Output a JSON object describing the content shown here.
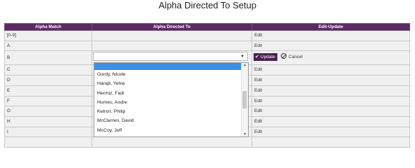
{
  "page": {
    "title": "Alpha Directed To Setup"
  },
  "table": {
    "headers": [
      "Alpha Match",
      "Alpha Directed To",
      "Edit-Update"
    ],
    "rows": [
      {
        "alpha": "[0-9]",
        "directed_to": "",
        "action": "Edit"
      },
      {
        "alpha": "A",
        "directed_to": "",
        "action": "Edit"
      },
      {
        "alpha": "B",
        "directed_to": "",
        "action": ""
      },
      {
        "alpha": "C",
        "directed_to": "",
        "action": "Edit"
      },
      {
        "alpha": "D",
        "directed_to": "",
        "action": "Edit"
      },
      {
        "alpha": "E",
        "directed_to": "",
        "action": "Edit"
      },
      {
        "alpha": "F",
        "directed_to": "",
        "action": "Edit"
      },
      {
        "alpha": "G",
        "directed_to": "",
        "action": "Edit"
      },
      {
        "alpha": "H",
        "directed_to": "",
        "action": "Edit"
      },
      {
        "alpha": "I",
        "directed_to": "",
        "action": "Edit"
      },
      {
        "alpha": "",
        "directed_to": "",
        "action": ""
      }
    ]
  },
  "edit_row": {
    "select_value": "",
    "update_label": "Update",
    "cancel_label": "Cancel"
  },
  "dropdown": {
    "options": [
      "Gordy, Nicole",
      "Harajli, Yehia",
      "Hermiz, Fadi",
      "Humes, Andre",
      "Ketron, Philip",
      "McClerren, David",
      "McCoy, Jeff"
    ]
  },
  "colors": {
    "header": "#5b2a63",
    "update_button": "#4a1f52",
    "highlight": "#3f8ee7"
  }
}
